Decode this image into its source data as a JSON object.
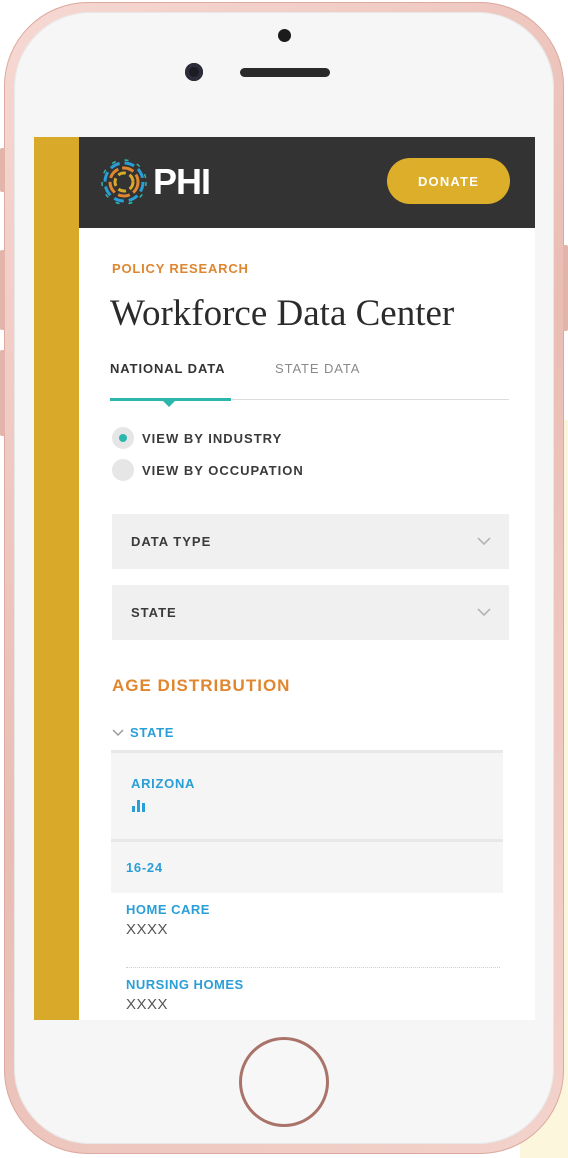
{
  "header": {
    "logo_text": "PHI",
    "donate_label": "DONATE"
  },
  "page": {
    "eyebrow": "POLICY RESEARCH",
    "title": "Workforce Data Center"
  },
  "tabs": [
    {
      "label": "NATIONAL DATA",
      "active": true
    },
    {
      "label": "STATE DATA",
      "active": false
    }
  ],
  "view_options": [
    {
      "label": "VIEW BY INDUSTRY",
      "selected": true
    },
    {
      "label": "VIEW BY OCCUPATION",
      "selected": false
    }
  ],
  "filters": {
    "data_type_label": "DATA TYPE",
    "state_label": "STATE"
  },
  "results": {
    "section_title": "AGE DISTRIBUTION",
    "state_toggle_label": "STATE",
    "state_value": "ARIZONA",
    "age_group": "16-24",
    "rows": [
      {
        "label": "HOME CARE",
        "value": "XXXX"
      },
      {
        "label": "NURSING HOMES",
        "value": "XXXX"
      }
    ]
  },
  "colors": {
    "gold": "#d9a92a",
    "orange": "#e0862f",
    "teal": "#2cb7ad",
    "blue": "#2a9ed6",
    "header": "#333333"
  }
}
